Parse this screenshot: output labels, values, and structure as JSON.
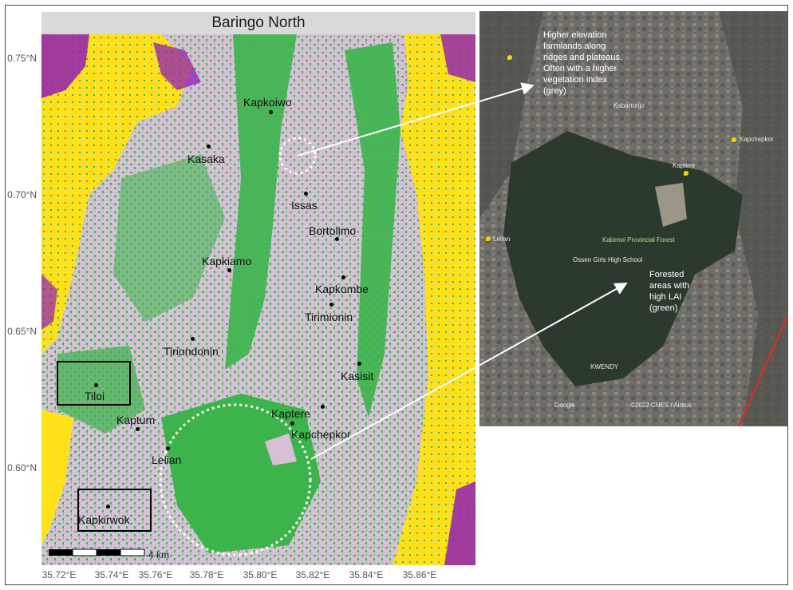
{
  "map": {
    "title": "Baringo North",
    "y_ticks": [
      "0.75°N",
      "0.70°N",
      "0.65°N",
      "0.60°N"
    ],
    "x_ticks": [
      "35.72°E",
      "35.74°E",
      "35.76°E",
      "35.78°E",
      "35.80°E",
      "35.82°E",
      "35.84°E",
      "35.86°E"
    ],
    "scale_label": "4 km",
    "places": [
      "Kapkoiwo",
      "Kasaka",
      "Issas",
      "Bortolimo",
      "Kapkiamo",
      "Kapkombe",
      "Tirimionin",
      "Tiriondonin",
      "Kasisit",
      "Tiloi",
      "Kaptum",
      "Kaptere",
      "Kapchepkor",
      "Lelian",
      "Kapkirwok"
    ],
    "colors": {
      "grey_class": "#d8bfd8",
      "green_class": "#3cb44b",
      "yellow_class": "#ffe119",
      "purple_class": "#911eb4"
    }
  },
  "satellite": {
    "annotations": {
      "top": "Higher elevation farmlands along ridges and plateaus.  Often with a higher vegetation index (grey)",
      "bottom": "Forested areas with high LAI (green)"
    },
    "labels": [
      "Kabartonjo",
      "Kapchepkor",
      "Kaptere",
      "Lelian",
      "Kabimoi Provincial Forest",
      "Ossen Girls High School",
      "KWENDY",
      "Google",
      "©2022 CNES / Airbus"
    ]
  }
}
